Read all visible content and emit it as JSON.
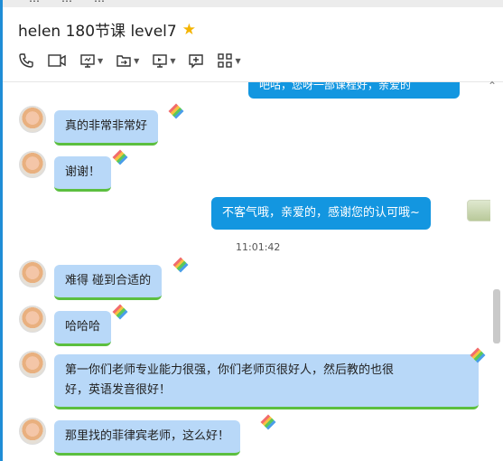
{
  "window": {
    "top_tabs": [
      "…",
      "…",
      "…"
    ]
  },
  "header": {
    "title": "helen 180节课 level7",
    "star_icon": "star-icon"
  },
  "toolbar": {
    "items": [
      {
        "icon": "phone-icon"
      },
      {
        "icon": "video-icon"
      },
      {
        "icon": "screen-share-icon"
      },
      {
        "icon": "file-transfer-icon"
      },
      {
        "icon": "remote-desktop-icon"
      },
      {
        "icon": "add-comment-icon"
      },
      {
        "icon": "apps-grid-icon"
      }
    ]
  },
  "chat": {
    "partial_top": "吧咕，您呀一部课程好，亲爱的",
    "timestamp": "11:01:42",
    "messages": [
      {
        "side": "left",
        "text": "真的非常非常好"
      },
      {
        "side": "left",
        "text": "谢谢！"
      },
      {
        "side": "right",
        "text": "不客气哦，亲爱的，感谢您的认可哦~"
      },
      {
        "side": "left",
        "text": "难得 碰到合适的"
      },
      {
        "side": "left",
        "text": "哈哈哈"
      },
      {
        "side": "left",
        "text_line1": "第一你们老师专业能力很强，你们老师页很好人，然后教的也很",
        "text_line2": "好，英语发音很好！"
      },
      {
        "side": "left",
        "text": "那里找的菲律宾老师，这么好！"
      }
    ]
  },
  "colors": {
    "accent": "#1396e0",
    "incoming_bubble": "#b8d8f8",
    "bubble_underline": "#5cbf3f"
  }
}
